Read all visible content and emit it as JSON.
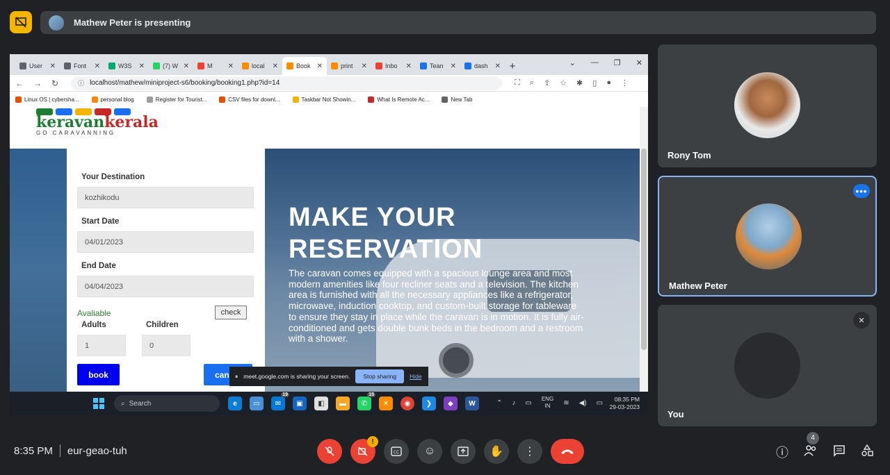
{
  "presenting_bar": {
    "text": "Mathew Peter is presenting"
  },
  "browser": {
    "tabs": [
      {
        "label": "User",
        "color": "#5f6368"
      },
      {
        "label": "Font",
        "color": "#5f6368"
      },
      {
        "label": "W3S",
        "color": "#04aa6d"
      },
      {
        "label": "(7) W",
        "color": "#25d366"
      },
      {
        "label": "M",
        "color": "#ea4335"
      },
      {
        "label": "local",
        "color": "#fb8c00"
      },
      {
        "label": "Book",
        "color": "#fb8c00"
      },
      {
        "label": "print",
        "color": "#fb8c00"
      },
      {
        "label": "Inbo",
        "color": "#ea4335"
      },
      {
        "label": "Tean",
        "color": "#1a73e8"
      },
      {
        "label": "dash",
        "color": "#1a73e8"
      }
    ],
    "active_tab_index": 6,
    "url": "localhost/mathew/miniproject-s6/booking/booking1.php?id=14",
    "bookmarks": [
      {
        "label": "Linux OS | cybersha...",
        "color": "#e65100"
      },
      {
        "label": "personal blog",
        "color": "#fb8c00"
      },
      {
        "label": "Register for Tourist...",
        "color": "#9e9e9e"
      },
      {
        "label": "CSV files for downl...",
        "color": "#e65100"
      },
      {
        "label": "Taskbar Not Showin...",
        "color": "#f4b400"
      },
      {
        "label": "What Is Remote Ac...",
        "color": "#c62828"
      },
      {
        "label": "New Tab",
        "color": "#5f6368"
      }
    ]
  },
  "site": {
    "logo": {
      "brand_green": "keravan",
      "brand_red": "kerala",
      "tagline": "GO CARAVANNING"
    },
    "form": {
      "destination_label": "Your Destination",
      "destination_value": "kozhikodu",
      "start_label": "Start Date",
      "start_value": "04/01/2023",
      "end_label": "End Date",
      "end_value": "04/04/2023",
      "availability": "Avaliable",
      "check_label": "check",
      "adults_label": "Adults",
      "adults_value": "1",
      "children_label": "Children",
      "children_value": "0",
      "book_label": "book",
      "cancel_label": "can"
    },
    "hero": {
      "title_line1": "MAKE YOUR",
      "title_line2": "RESERVATION",
      "text": "The caravan comes equipped with a spacious lounge area and most modern amenities like four recliner seats and a television. The kitchen area is furnished with all the necessary appliances like a refrigerator, microwave, induction cooktop, and custom-built storage for tableware to ensure they stay in place while the caravan is in motion. It is fully air-conditioned and gets double bunk beds in the bedroom and a restroom with a shower."
    }
  },
  "share_notice": {
    "text": "meet.google.com is sharing your screen.",
    "stop_label": "Stop sharing",
    "hide_label": "Hide"
  },
  "taskbar": {
    "search_label": "Search",
    "lang_line1": "ENG",
    "lang_line2": "IN",
    "time": "08:35 PM",
    "date": "29-03-2023",
    "mail_badge": "19",
    "whatsapp_badge": "15"
  },
  "participants": [
    {
      "name": "Rony Tom"
    },
    {
      "name": "Mathew Peter"
    },
    {
      "name": "You"
    }
  ],
  "meeting": {
    "time": "8:35 PM",
    "code": "eur-geao-tuh",
    "people_count": "4"
  },
  "colors": {
    "accent": "#8ab4f8",
    "end_call": "#ea4335",
    "present_icon": "#f4b400"
  }
}
